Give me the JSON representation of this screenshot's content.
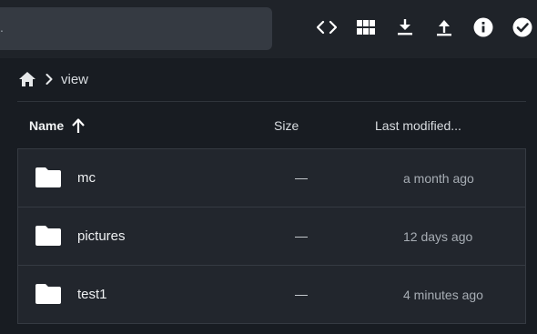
{
  "search": {
    "text": "."
  },
  "toolbar": {
    "icons": [
      "code-icon",
      "grid-view-icon",
      "download-icon",
      "upload-icon",
      "info-icon",
      "select-check-icon"
    ]
  },
  "breadcrumb": {
    "home_icon": "home-icon",
    "separator_icon": "chevron-right-icon",
    "current": "view"
  },
  "columns": {
    "name": "Name",
    "sort_icon": "arrow-up-icon",
    "size": "Size",
    "modified": "Last modified..."
  },
  "files": [
    {
      "name": "mc",
      "size": "—",
      "modified": "a month ago",
      "icon": "folder-icon"
    },
    {
      "name": "pictures",
      "size": "—",
      "modified": "12 days ago",
      "icon": "folder-icon"
    },
    {
      "name": "test1",
      "size": "—",
      "modified": "4 minutes ago",
      "icon": "folder-icon"
    }
  ],
  "colors": {
    "background": "#181c22",
    "topbar": "#1f2329",
    "search": "#353a42",
    "row": "#22262d",
    "row_border": "#353a42"
  }
}
